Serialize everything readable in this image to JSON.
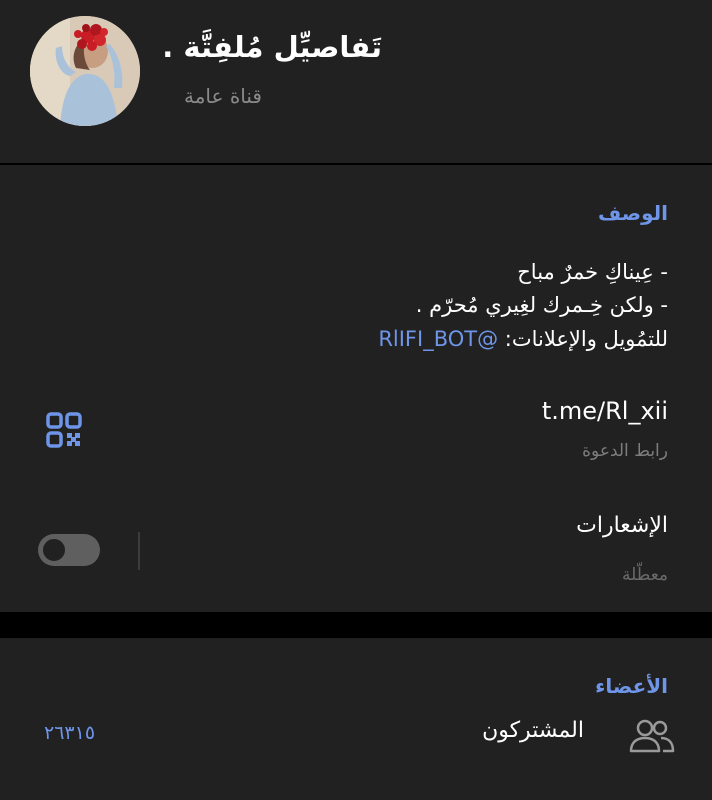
{
  "header": {
    "title": "تَفاصيِّل مُلفِتَّة .",
    "subtitle": "قناة عامة"
  },
  "info": {
    "description_label": "الوصف",
    "description_lines": [
      "- عِيناكِ خمرٌ مباح",
      "- ولكن خِـمرك لغِيري مُحرّم ."
    ],
    "ads_text": "للتمُويل والإعلانات: ",
    "ads_mention": "@RlIFI_BOT",
    "link": "t.me/Rl_xii",
    "link_caption": "رابط الدعوة",
    "notifications_label": "الإشعارات",
    "notifications_status": "معطّلة",
    "notifications_enabled": false
  },
  "members": {
    "label": "الأعضاء",
    "subscribers_label": "المشتركون",
    "subscribers_count": "٢٦٣١٥"
  },
  "colors": {
    "background": "#000000",
    "card": "#212121",
    "accent": "#6f95e8",
    "text": "#ffffff",
    "muted": "#8a8a8a"
  },
  "icons": {
    "qr": "qr-code-icon",
    "people": "people-icon",
    "toggle": "toggle-switch"
  }
}
